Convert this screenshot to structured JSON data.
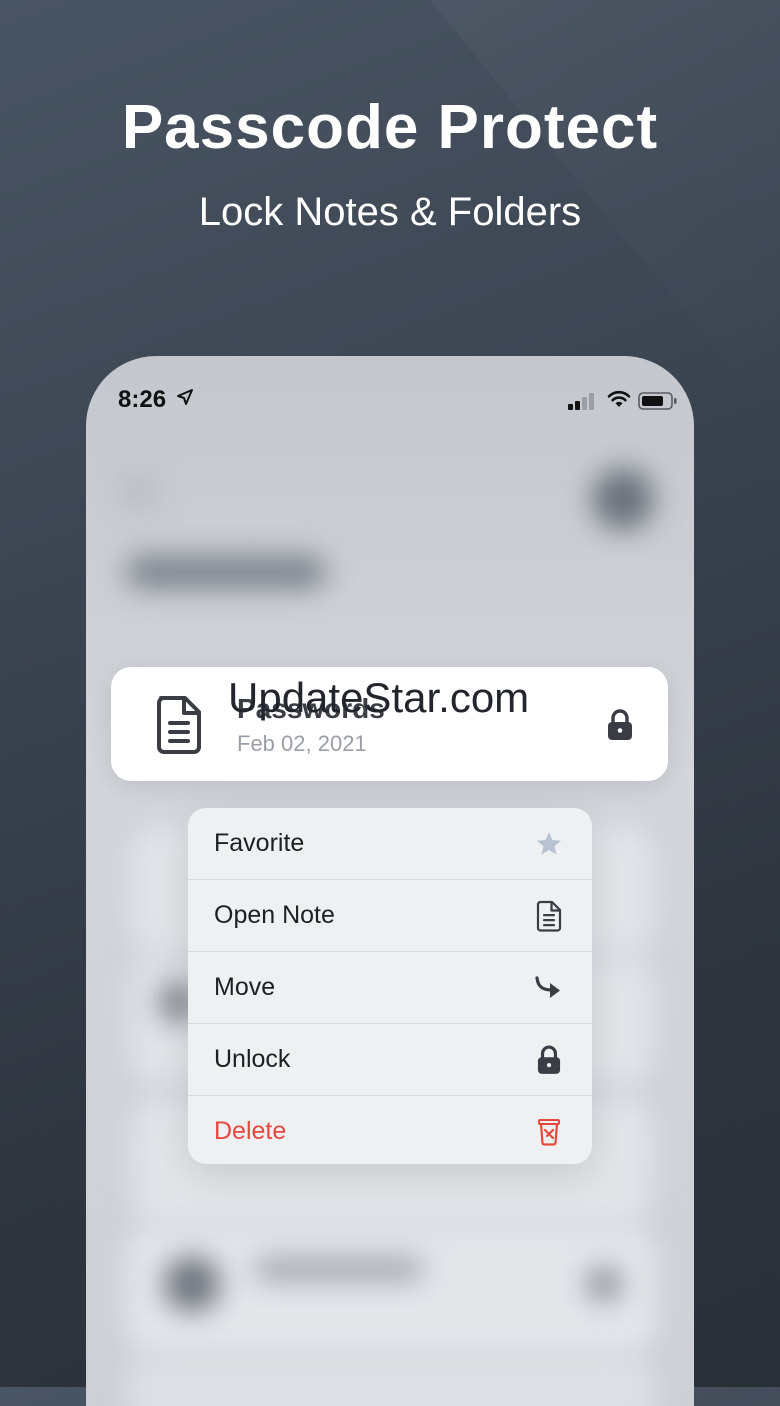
{
  "hero": {
    "title": "Passcode Protect",
    "subtitle": "Lock Notes & Folders"
  },
  "status_bar": {
    "time": "8:26"
  },
  "note": {
    "title": "Passwords",
    "date": "Feb 02, 2021"
  },
  "watermark": "UpdateStar.com",
  "context_menu": {
    "items": [
      {
        "label": "Favorite",
        "icon": "star-icon"
      },
      {
        "label": "Open Note",
        "icon": "document-icon"
      },
      {
        "label": "Move",
        "icon": "move-arrow-icon"
      },
      {
        "label": "Unlock",
        "icon": "lock-icon"
      },
      {
        "label": "Delete",
        "icon": "trash-icon"
      }
    ]
  },
  "colors": {
    "danger": "#e5483e",
    "background": "#3c4552",
    "card": "#ffffff"
  }
}
